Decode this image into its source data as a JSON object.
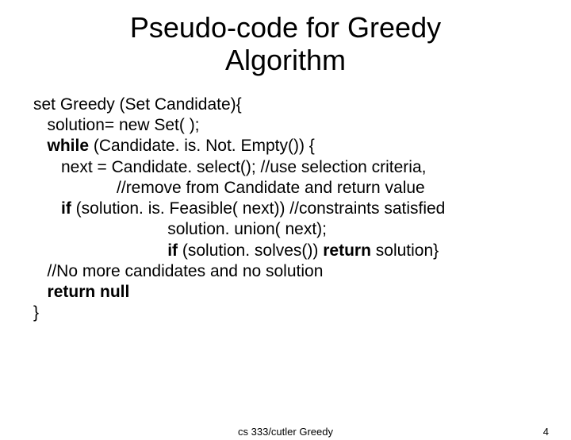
{
  "title_line1": "Pseudo-code for Greedy",
  "title_line2": "Algorithm",
  "code": {
    "l1": "set Greedy (Set Candidate){",
    "l2": "   solution= new Set( );",
    "l3a": "   ",
    "l3b": "while",
    "l3c": " (Candidate. is. Not. Empty()) {",
    "l4": "      next = Candidate. select(); //use selection criteria,",
    "l5": "                  //remove from Candidate and return value",
    "l6a": "      ",
    "l6b": "if",
    "l6c": " (solution. is. Feasible( next)) //constraints satisfied",
    "l7": "                             solution. union( next);",
    "l8a": "                             ",
    "l8b": "if",
    "l8c": " (solution. solves()) ",
    "l8d": "return",
    "l8e": " solution}",
    "l9": "   //No more candidates and no solution",
    "l10a": "   ",
    "l10b": "return null",
    "l11": "}"
  },
  "footer_center": "cs 333/cutler   Greedy",
  "footer_right": "4"
}
